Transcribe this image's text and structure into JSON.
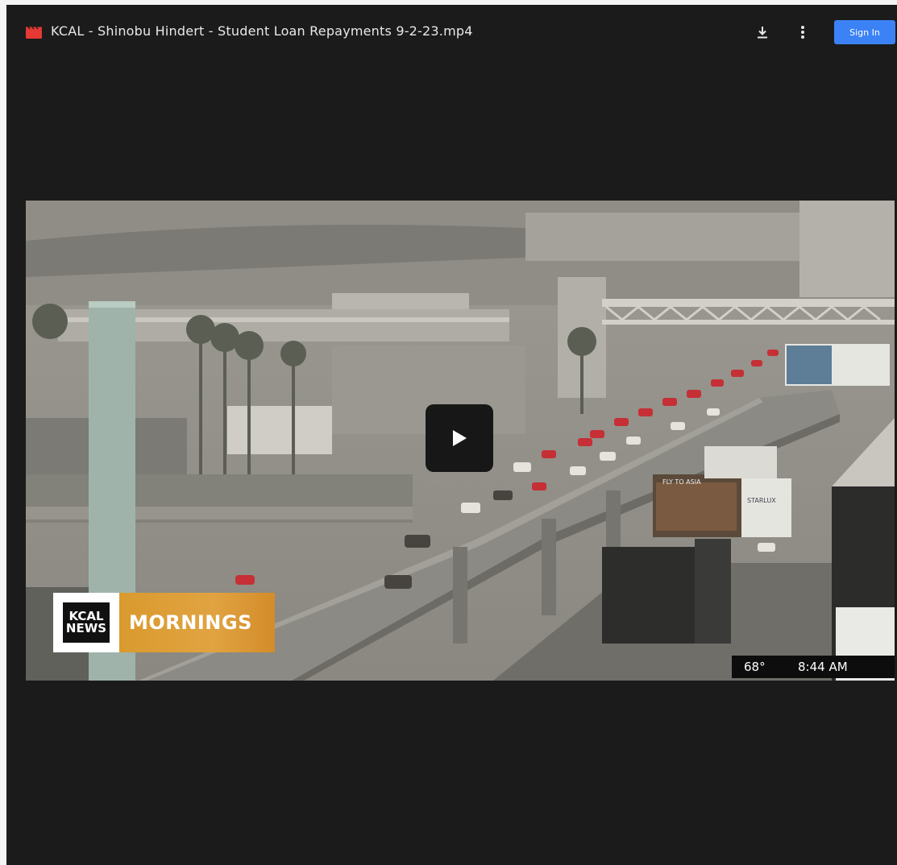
{
  "header": {
    "file_icon": "clapperboard-icon",
    "title": "KCAL - Shinobu Hindert - Student Loan Repayments 9-2-23.mp4",
    "download_icon": "download-icon",
    "more_icon": "more-vertical-icon",
    "signin_label": "Sign In",
    "signin_color": "#3b82f6"
  },
  "video": {
    "play_icon": "play-icon",
    "logo_line1": "KCAL",
    "logo_line2": "NEWS",
    "show_name": "MORNINGS",
    "show_color": "#e1a341",
    "temperature": "68°",
    "time": "8:44 AM",
    "billboard_left": "FLY TO ASIA",
    "billboard_right": "STARLUX"
  }
}
